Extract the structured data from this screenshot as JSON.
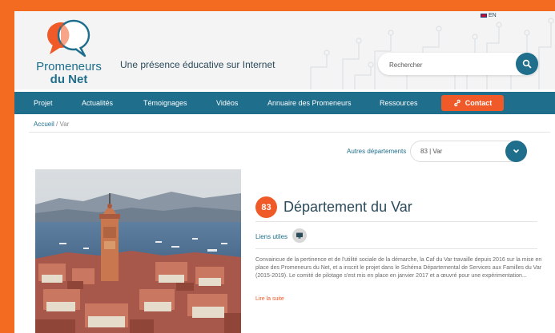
{
  "header": {
    "logo_line1": "Promeneurs",
    "logo_line2": "du Net",
    "tagline": "Une présence éducative sur Internet",
    "lang_label": "EN",
    "search": {
      "placeholder": "Rechercher"
    }
  },
  "nav": {
    "items": [
      "Projet",
      "Actualités",
      "Témoignages",
      "Vidéos",
      "Annuaire des Promeneurs",
      "Ressources"
    ],
    "contact_label": "Contact"
  },
  "breadcrumb": {
    "home": "Accueil",
    "separator": "/",
    "current": "Var"
  },
  "department_selector": {
    "label": "Autres départements",
    "value": "83 | Var"
  },
  "department": {
    "number": "83",
    "title": "Département du Var",
    "links_label": "Liens utiles",
    "description": "Convaincue de la pertinence et de l'utilité sociale de la démarche, la Caf du Var travaille depuis 2016 sur la mise en place des Promeneurs du Net, et a inscrit le projet dans le Schéma Départemental de Services aux Familles du Var (2015-2019). Le comité de pilotage s'est mis en place en janvier 2017 et a œuvré pour une expérimentation...",
    "read_more": "Lire la suite"
  },
  "colors": {
    "accent": "#f05a28",
    "brand": "#1f6e8c",
    "frame": "#f26b21"
  },
  "icons": [
    "speech-bubbles-logo-icon",
    "uk-flag-icon",
    "search-icon",
    "link-icon",
    "chevron-down-icon",
    "monitor-icon"
  ]
}
